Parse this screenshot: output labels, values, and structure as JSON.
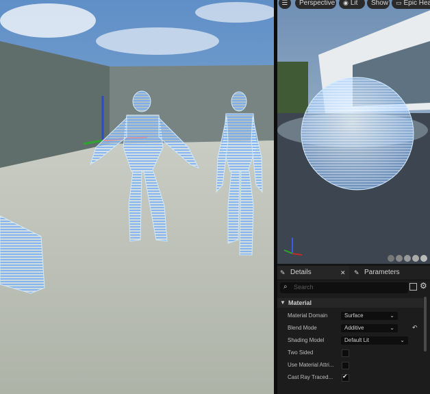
{
  "viewport_toolbar": {
    "menu_icon": "hamburger-icon",
    "perspective_label": "Perspective",
    "lit_label": "Lit",
    "show_label": "Show",
    "preview_mesh_label": "Epic Hea"
  },
  "details_panel": {
    "tabs": [
      {
        "label": "Details",
        "icon": "pencil-icon",
        "active": true
      },
      {
        "label": "Parameters",
        "icon": "pencil-icon",
        "active": false
      }
    ],
    "search_placeholder": "Search",
    "category": "Material",
    "properties": [
      {
        "label": "Material Domain",
        "type": "dropdown",
        "value": "Surface"
      },
      {
        "label": "Blend Mode",
        "type": "dropdown",
        "value": "Additive",
        "reset": true
      },
      {
        "label": "Shading Model",
        "type": "dropdown",
        "value": "Default Lit"
      },
      {
        "label": "Two Sided",
        "type": "checkbox",
        "checked": false
      },
      {
        "label": "Use Material Attri...",
        "type": "checkbox",
        "checked": false
      },
      {
        "label": "Cast Ray Traced...",
        "type": "checkbox",
        "checked": true
      }
    ]
  },
  "colors": {
    "sky": "#7ea8d4",
    "hologram": "#9fd3ff",
    "panel_bg": "#1c1c1c"
  }
}
